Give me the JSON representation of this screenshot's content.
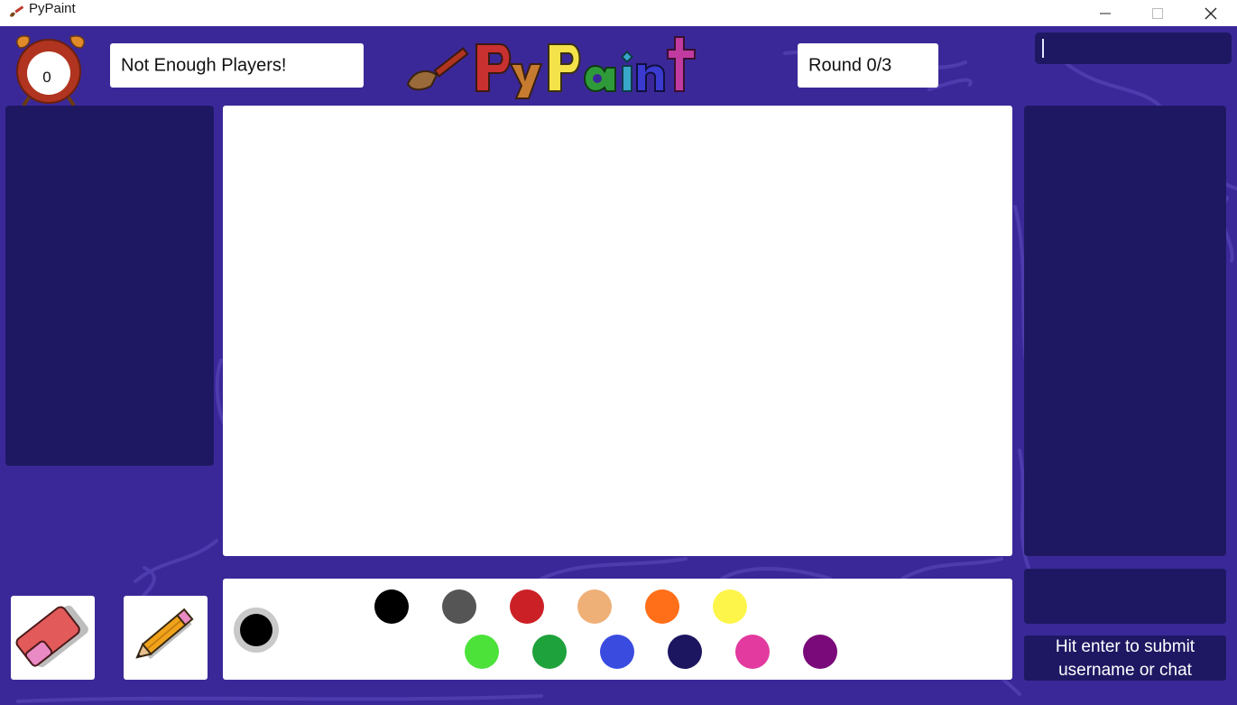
{
  "window": {
    "title": "PyPaint",
    "controls": {
      "minimize": "—",
      "maximize": "☐",
      "close": "✕"
    }
  },
  "header": {
    "timer": "0",
    "status": "Not Enough Players!",
    "logo_text": "PyPaint",
    "round": "Round 0/3"
  },
  "chat": {
    "input_value": "",
    "hint": "Hit enter to submit username or chat"
  },
  "palette": {
    "current_color": "#000000",
    "colors_row1": [
      "#000000",
      "#555555",
      "#cc2027",
      "#efb078",
      "#ff6f1a",
      "#fdf54a"
    ],
    "colors_row2": [
      "#4de23a",
      "#1ea23c",
      "#3a4be0",
      "#1c1660",
      "#e23a9e",
      "#7a0a7a"
    ]
  },
  "tools": {
    "eraser": "eraser-icon",
    "pencil": "pencil-icon"
  }
}
